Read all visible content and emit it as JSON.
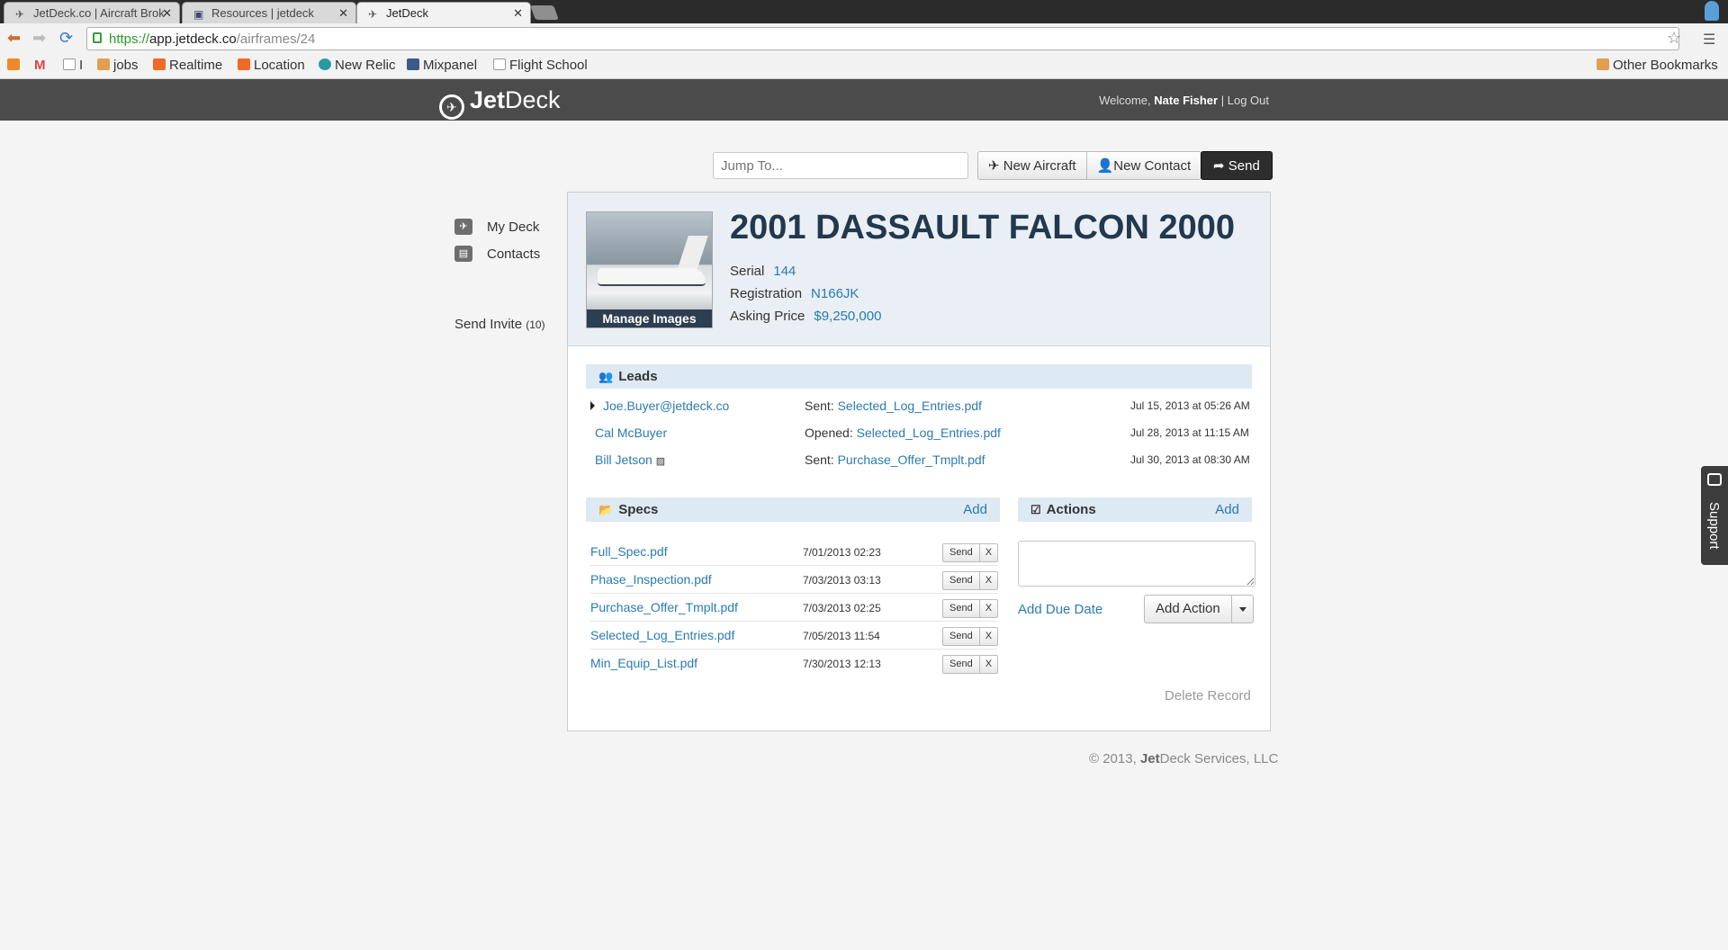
{
  "browser": {
    "tabs": [
      {
        "title": "JetDeck.co | Aircraft Brok"
      },
      {
        "title": "Resources | jetdeck"
      },
      {
        "title": "JetDeck"
      }
    ],
    "url_scheme": "https://",
    "url_host": "app.jetdeck.co",
    "url_path": "/airframes/24",
    "bookmarks": [
      {
        "label": "",
        "icon": "rss-icon",
        "color": "#f08a24"
      },
      {
        "label": "",
        "icon": "gmail-icon",
        "color": "#d44"
      },
      {
        "label": "I",
        "icon": "page-icon",
        "color": "#ffffff"
      },
      {
        "label": "jobs",
        "icon": "folder-icon",
        "color": "#e0a050"
      },
      {
        "label": "Realtime",
        "icon": "chart-icon",
        "color": "#f06a24"
      },
      {
        "label": "Location",
        "icon": "chart-icon",
        "color": "#f06a24"
      },
      {
        "label": "New Relic",
        "icon": "newrelic-icon",
        "color": "#2a9aa0"
      },
      {
        "label": "Mixpanel",
        "icon": "mixpanel-icon",
        "color": "#3a5a8a"
      },
      {
        "label": "Flight School",
        "icon": "page-icon",
        "color": "#ffffff"
      }
    ],
    "other_bookmarks": "Other Bookmarks"
  },
  "app": {
    "logo_bold": "Jet",
    "logo_rest": "Deck",
    "welcome_prefix": "Welcome,",
    "user_name": "Nate Fisher",
    "separator": "|",
    "logout": "Log Out"
  },
  "actions_row": {
    "jump_placeholder": "Jump To...",
    "new_aircraft": "New Aircraft",
    "new_contact": "New Contact",
    "send": "Send"
  },
  "sidebar": {
    "items": [
      {
        "label": "My Deck",
        "icon": "plane-icon"
      },
      {
        "label": "Contacts",
        "icon": "book-icon"
      }
    ],
    "invite_label": "Send Invite",
    "invite_count": "(10)"
  },
  "aircraft": {
    "title": "2001 DASSAULT FALCON 2000",
    "manage_images": "Manage Images",
    "serial_label": "Serial",
    "serial": "144",
    "registration_label": "Registration",
    "registration": "N166JK",
    "price_label": "Asking Price",
    "price": "$9,250,000"
  },
  "leads": {
    "title": "Leads",
    "rows": [
      {
        "contact": "Joe.Buyer@jetdeck.co",
        "action": "Sent:",
        "file": "Selected_Log_Entries.pdf",
        "date": "Jul 15, 2013 at 05:26 AM"
      },
      {
        "contact": "Cal McBuyer",
        "action": "Opened:",
        "file": "Selected_Log_Entries.pdf",
        "date": "Jul 28, 2013 at 11:15 AM"
      },
      {
        "contact": "Bill Jetson",
        "action": "Sent:",
        "file": "Purchase_Offer_Tmplt.pdf",
        "date": "Jul 30, 2013 at 08:30 AM"
      }
    ]
  },
  "specs": {
    "title": "Specs",
    "add": "Add",
    "send_label": "Send",
    "remove_label": "X",
    "rows": [
      {
        "file": "Full_Spec.pdf",
        "date": "7/01/2013 02:23"
      },
      {
        "file": "Phase_Inspection.pdf",
        "date": "7/03/2013 03:13"
      },
      {
        "file": "Purchase_Offer_Tmplt.pdf",
        "date": "7/03/2013 02:25"
      },
      {
        "file": "Selected_Log_Entries.pdf",
        "date": "7/05/2013 11:54"
      },
      {
        "file": "Min_Equip_List.pdf",
        "date": "7/30/2013 12:13"
      }
    ]
  },
  "actions_panel": {
    "title": "Actions",
    "add": "Add",
    "add_due_date": "Add Due Date",
    "add_action": "Add Action"
  },
  "delete_record": "Delete Record",
  "footer": {
    "prefix": "© 2013,",
    "bold": "Jet",
    "rest": "Deck Services, LLC"
  },
  "support": "Support"
}
